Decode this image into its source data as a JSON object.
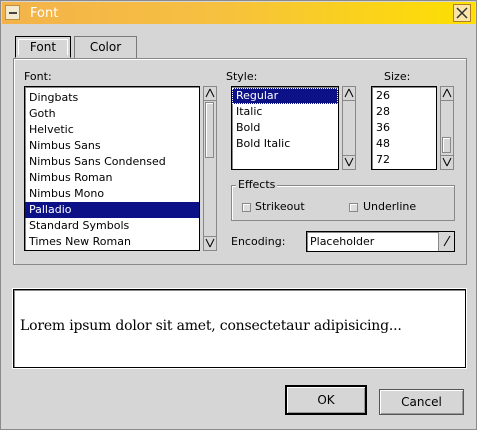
{
  "window": {
    "title": "Font"
  },
  "tabs": [
    "Font",
    "Color"
  ],
  "labels": {
    "font": "Font:",
    "style": "Style:",
    "size": "Size:",
    "effects": "Effects",
    "encoding": "Encoding:"
  },
  "fonts": {
    "items": [
      "Dingbats",
      "Goth",
      "Helvetic",
      "Nimbus Sans",
      "Nimbus Sans Condensed",
      "Nimbus Roman",
      "Nimbus Mono",
      "Palladio",
      "Standard Symbols",
      "Times New Roman"
    ],
    "selected": "Palladio"
  },
  "styles": {
    "items": [
      "Regular",
      "Italic",
      "Bold",
      "Bold Italic"
    ],
    "selected": "Regular"
  },
  "sizes": {
    "items": [
      "26",
      "28",
      "36",
      "48",
      "72"
    ]
  },
  "effects": {
    "strikeout": "Strikeout",
    "underline": "Underline",
    "strikeout_checked": false,
    "underline_checked": false
  },
  "encoding": {
    "value": "Placeholder"
  },
  "preview": {
    "text": "Lorem ipsum dolor sit amet, consectetaur adipisicing..."
  },
  "buttons": {
    "ok": "OK",
    "cancel": "Cancel"
  },
  "colors": {
    "title_start": "#f3b34a",
    "title_end": "#fde000",
    "selection": "#0c1188",
    "background": "#d6d6d6"
  }
}
